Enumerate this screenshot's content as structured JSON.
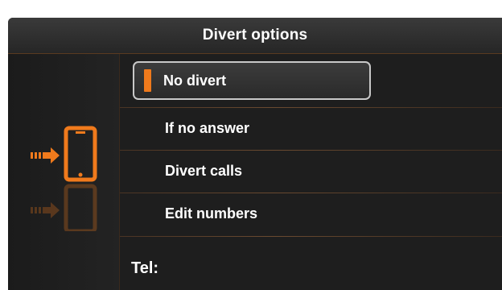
{
  "header": {
    "title": "Divert options"
  },
  "menu": {
    "items": [
      {
        "label": "No divert",
        "selected": true
      },
      {
        "label": "If no answer",
        "selected": false
      },
      {
        "label": "Divert calls",
        "selected": false
      },
      {
        "label": "Edit numbers",
        "selected": false
      }
    ]
  },
  "tel": {
    "label": "Tel:"
  },
  "colors": {
    "accent": "#f07a1c",
    "background": "#1e1e1e",
    "text": "#ffffff"
  },
  "icons": {
    "divert": "phone-divert-icon"
  }
}
